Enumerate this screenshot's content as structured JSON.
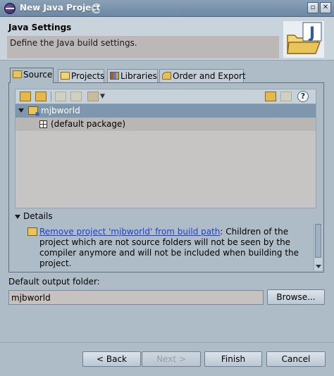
{
  "window": {
    "title": "New Java Project"
  },
  "banner": {
    "title": "Java Settings",
    "description": "Define the Java build settings."
  },
  "tabs": [
    {
      "label": "Source",
      "active": true,
      "icon": "source-folder-icon"
    },
    {
      "label": "Projects",
      "active": false,
      "icon": "projects-icon"
    },
    {
      "label": "Libraries",
      "active": false,
      "icon": "libraries-icon"
    },
    {
      "label": "Order and Export",
      "active": false,
      "icon": "order-export-icon"
    }
  ],
  "tree": {
    "items": [
      {
        "label": "mjbworld",
        "selected": true,
        "icon": "java-project-icon",
        "expanded": true
      },
      {
        "label": "(default package)",
        "selected": false,
        "icon": "package-icon"
      }
    ]
  },
  "details": {
    "label": "Details",
    "link_text": "Remove project 'mjbworld' from build path",
    "rest_text": ": Children of the project which are not source folders will not be seen by the compiler anymore and will not be included when building the project."
  },
  "output": {
    "label": "Default output folder:",
    "value": "mjbworld",
    "browse_label": "Browse..."
  },
  "buttons": {
    "back": "< Back",
    "next": "Next >",
    "finish": "Finish",
    "cancel": "Cancel"
  },
  "toolbar": {
    "help": "?"
  },
  "colors": {
    "window_bg": "#aebcc8",
    "selection": "#7f97ae",
    "link": "#1f3fd1"
  }
}
